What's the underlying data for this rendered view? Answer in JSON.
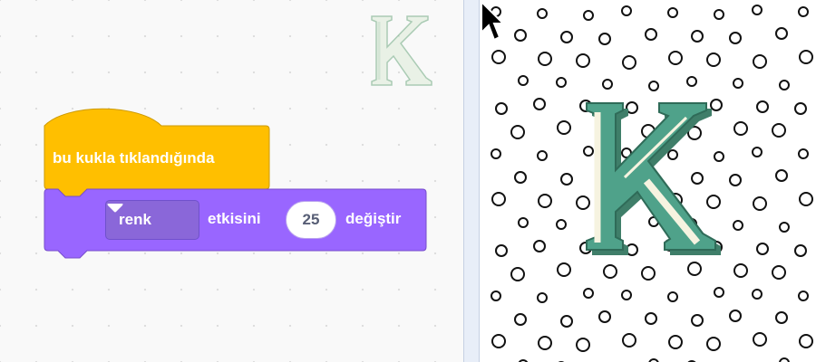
{
  "code_area": {
    "hat_block": {
      "label": "bu kukla tıklandığında",
      "color": "#ffbf00",
      "border_color": "#cc9900"
    },
    "effect_block": {
      "dropdown_value": "renk",
      "text_middle": "etkisini",
      "amount": "25",
      "text_end": "değiştir",
      "color": "#9966ff",
      "border_color": "#774dcb"
    },
    "sprite_watermark_icon": "letter-k-icon"
  },
  "stage": {
    "backdrop_icon": "polka-dots-backdrop",
    "sprite_icon": "letter-k-icon",
    "sprite_color": "#4fa28a",
    "cursor_icon": "arrow-cursor-icon"
  }
}
